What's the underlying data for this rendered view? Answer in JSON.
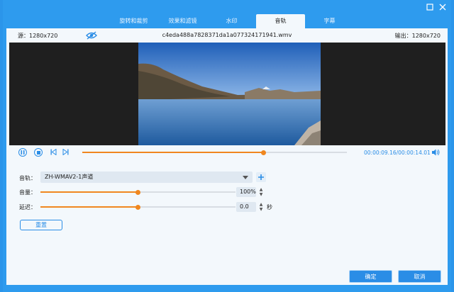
{
  "window": {
    "minimize_icon": "maximize-square-icon",
    "close_icon": "close-icon"
  },
  "tabs": [
    {
      "label": "旋转和裁剪",
      "active": false
    },
    {
      "label": "效果和滤镜",
      "active": false
    },
    {
      "label": "水印",
      "active": false
    },
    {
      "label": "音轨",
      "active": true
    },
    {
      "label": "字幕",
      "active": false
    }
  ],
  "info": {
    "source": "源：1280x720",
    "filename": "c4eda488a7828371da1a077324171941.wmv",
    "output": "输出：1280x720"
  },
  "player": {
    "current_time": "00:00:09.16",
    "total_time": "/00:00:14.01",
    "progress": 0.685
  },
  "audio": {
    "track_label": "音轨：",
    "track_value": "ZH-WMAV2-1声道",
    "volume_label": "音量：",
    "volume_value": "100%",
    "volume_level": 0.5,
    "delay_label": "延迟：",
    "delay_value": "0.0",
    "delay_level": 0.5,
    "delay_unit": "秒",
    "reset_label": "重置"
  },
  "footer": {
    "ok_label": "确定",
    "cancel_label": "取消"
  },
  "colors": {
    "accent": "#2a8de6",
    "progress": "#f0871f",
    "titlebar": "#2e9bee"
  }
}
